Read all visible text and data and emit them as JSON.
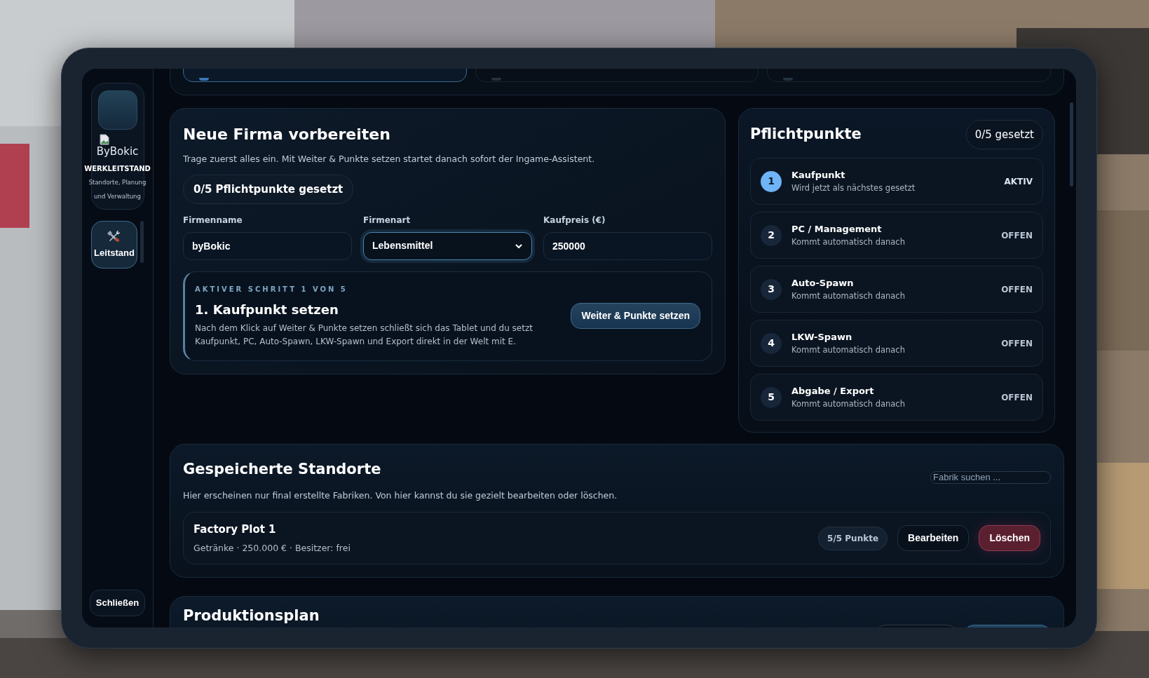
{
  "sidebar": {
    "logo_alt": "ByBokic",
    "title": "WERKLEITSTAND",
    "subtitle": "Standorte, Planung und Verwaltung",
    "nav": [
      {
        "label": "Leitstand",
        "selected": true
      }
    ],
    "close_button": "Schließen"
  },
  "top_steps": [
    {
      "selected": true
    },
    {
      "selected": false
    },
    {
      "selected": false
    }
  ],
  "new_company": {
    "title": "Neue Firma vorbereiten",
    "description": "Trage zuerst alles ein. Mit Weiter & Punkte setzen startet danach sofort der Ingame-Assistent.",
    "progress_badge": "0/5 Pflichtpunkte gesetzt",
    "fields": [
      {
        "kind": "text",
        "label": "Firmenname",
        "value": "byBokic",
        "focused": false
      },
      {
        "kind": "select",
        "label": "Firmenart",
        "value": "Lebensmittel",
        "focused": true
      },
      {
        "kind": "text",
        "label": "Kaufpreis (€)",
        "value": "250000",
        "focused": false
      }
    ],
    "active_step": {
      "eyebrow": "AKTIVER SCHRITT 1 VON 5",
      "title": "1. Kaufpunkt setzen",
      "description": "Nach dem Klick auf Weiter & Punkte setzen schließt sich das Tablet und du setzt Kaufpunkt, PC, Auto-Spawn, LKW-Spawn und Export direkt in der Welt mit E.",
      "button": "Weiter & Punkte setzen"
    }
  },
  "checkpoints": {
    "title": "Pflichtpunkte",
    "badge": "0/5 gesetzt",
    "items": [
      {
        "number": "1",
        "title": "Kaufpunkt",
        "subtitle": "Wird jetzt als nächstes gesetzt",
        "status": "AKTIV",
        "active": true
      },
      {
        "number": "2",
        "title": "PC / Management",
        "subtitle": "Kommt automatisch danach",
        "status": "OFFEN",
        "active": false
      },
      {
        "number": "3",
        "title": "Auto-Spawn",
        "subtitle": "Kommt automatisch danach",
        "status": "OFFEN",
        "active": false
      },
      {
        "number": "4",
        "title": "LKW-Spawn",
        "subtitle": "Kommt automatisch danach",
        "status": "OFFEN",
        "active": false
      },
      {
        "number": "5",
        "title": "Abgabe / Export",
        "subtitle": "Kommt automatisch danach",
        "status": "OFFEN",
        "active": false
      }
    ]
  },
  "saved_locations": {
    "title": "Gespeicherte Standorte",
    "description": "Hier erscheinen nur final erstellte Fabriken. Von hier kannst du sie gezielt bearbeiten oder löschen.",
    "search": {
      "placeholder": "Fabrik suchen ..."
    },
    "items": [
      {
        "title": "Factory Plot 1",
        "meta": "Getränke · 250.000 € · Besitzer: frei",
        "points": "5/5 Punkte",
        "edit": "Bearbeiten",
        "delete": "Löschen"
      }
    ]
  },
  "production": {
    "title": "Produktionsplan"
  }
}
